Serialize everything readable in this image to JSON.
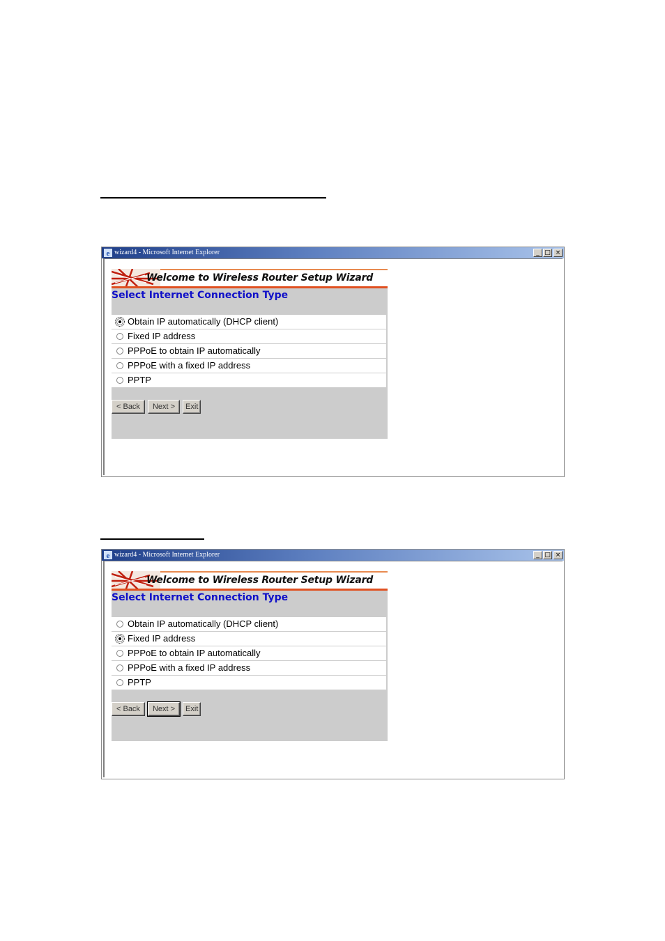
{
  "windows": [
    {
      "title": "wizard4 - Microsoft Internet Explorer",
      "window_controls": {
        "minimize": "_",
        "maximize": "□",
        "close": "×"
      },
      "banner_text": "Welcome to Wireless Router Setup Wizard",
      "heading": "Select Internet Connection Type",
      "options": [
        {
          "label": "Obtain IP automatically (DHCP client)",
          "selected": true
        },
        {
          "label": "Fixed IP address",
          "selected": false
        },
        {
          "label": "PPPoE to obtain IP automatically",
          "selected": false
        },
        {
          "label": "PPPoE with a fixed IP address",
          "selected": false
        },
        {
          "label": "PPTP",
          "selected": false
        }
      ],
      "buttons": {
        "back": "< Back",
        "next": "Next >",
        "exit": "Exit"
      }
    },
    {
      "title": "wizard4 - Microsoft Internet Explorer",
      "window_controls": {
        "minimize": "_",
        "maximize": "□",
        "close": "×"
      },
      "banner_text": "Welcome to Wireless Router Setup Wizard",
      "heading": "Select Internet Connection Type",
      "options": [
        {
          "label": "Obtain IP automatically (DHCP client)",
          "selected": false
        },
        {
          "label": "Fixed IP address",
          "selected": true
        },
        {
          "label": "PPPoE to obtain IP automatically",
          "selected": false
        },
        {
          "label": "PPPoE with a fixed IP address",
          "selected": false
        },
        {
          "label": "PPTP",
          "selected": false
        }
      ],
      "buttons": {
        "back": "< Back",
        "next": "Next >",
        "exit": "Exit"
      }
    }
  ],
  "colors": {
    "heading": "#1010c8",
    "banner_accent": "#e05020",
    "panel_bg": "#cccccc"
  }
}
